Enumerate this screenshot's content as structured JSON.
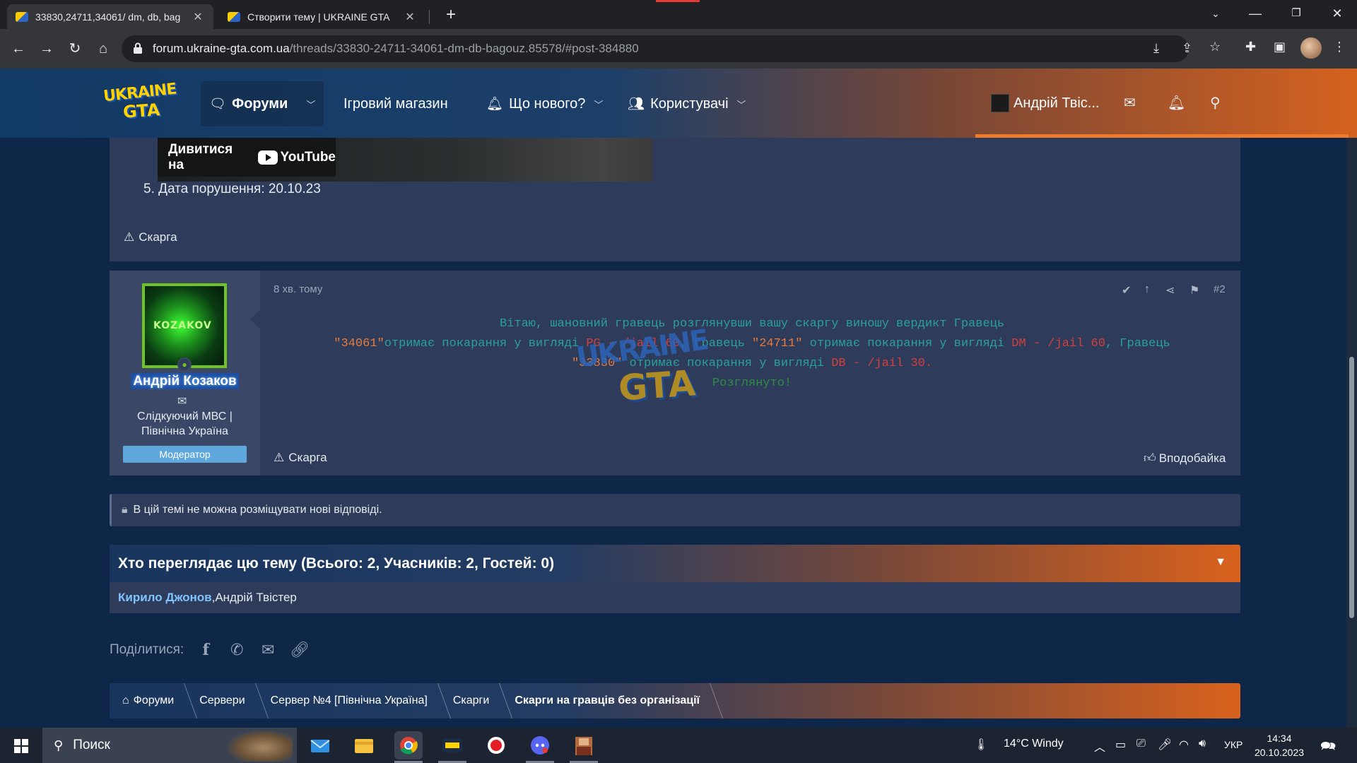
{
  "browser": {
    "tabs": [
      {
        "title": "33830,24711,34061/ dm, db, baɡ",
        "active": true
      },
      {
        "title": "Створити тему | UKRAINE GTA",
        "active": false
      }
    ],
    "url_host": "forum.ukraine-gta.com.ua",
    "url_path": "/threads/33830-24711-34061-dm-db-bagouz.85578/#post-384880"
  },
  "site": {
    "logo_line1": "UKRAINE",
    "logo_line2": "GTA",
    "nav": {
      "forums": "Форуми",
      "shop": "Ігровий магазин",
      "whats_new": "Що нового?",
      "members": "Користувачі"
    },
    "user_name": "Андрій Твіс..."
  },
  "post1": {
    "video_label": "Дивитися на",
    "video_brand": "YouTube",
    "violation_date": "5. Дата порушення: 20.10.23",
    "report": "Скарга"
  },
  "post2": {
    "author": "Андрій Козаков",
    "avatar_text": "KOZAKOV",
    "user_title_line1": "Слідкуючий МВС |",
    "user_title_line2": "Північна Україна",
    "role": "Модератор",
    "time": "8 хв. тому",
    "post_number": "#2",
    "message": {
      "line1": "Вітаю, шановний гравець розглянувши вашу скаргу виношу вердикт Гравець",
      "p1": "\"34061\"",
      "t1": "отримає покарання у вигляді ",
      "pun1": "PG - /jail 60",
      "t2": ", Гравець ",
      "p2": "\"24711\"",
      "t3": " отримає покарання у вигляді ",
      "pun2": "DM - /jail 60",
      "t4": ", Гравець",
      "p3": "\"33830\"",
      "t5": " отримає покарання у вигляді ",
      "pun3": "DB - /jail 30.",
      "status": "Розглянуто!"
    },
    "watermark_line1": "UKRAINE",
    "watermark_line2": "GTA",
    "report": "Скарга",
    "like": "Вподобайка"
  },
  "locked_notice": "В цій темі не можна розміщувати нові відповіді.",
  "viewers": {
    "title": "Хто переглядає цю тему (Всього: 2, Учасників: 2, Гостей: 0)",
    "user1": "Кирило Джонов",
    "separator": ", ",
    "user2": "Андрій Твістер"
  },
  "share_label": "Поділитися:",
  "breadcrumbs": [
    "Форуми",
    "Сервери",
    "Сервер №4 [Північна Україна]",
    "Скарги",
    "Скарги на гравців без організації"
  ],
  "taskbar": {
    "search_placeholder": "Поиск",
    "weather": "14°C  Windy",
    "lang": "УКР",
    "time": "14:34",
    "date": "20.10.2023"
  }
}
